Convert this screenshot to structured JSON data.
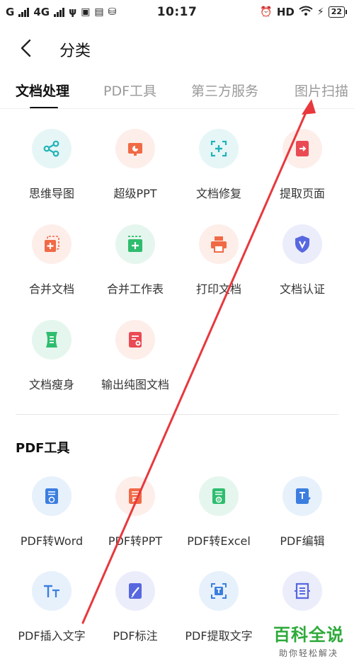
{
  "status_bar": {
    "carrier1": "G",
    "carrier2": "4G",
    "time": "10:17",
    "hd": "HD",
    "battery": "22"
  },
  "header": {
    "back_icon": "chevron-left-icon",
    "title": "分类"
  },
  "tabs": [
    {
      "label": "文档处理",
      "active": true
    },
    {
      "label": "PDF工具",
      "active": false
    },
    {
      "label": "第三方服务",
      "active": false
    },
    {
      "label": "图片扫描",
      "active": false
    }
  ],
  "doc_tools": [
    {
      "label": "思维导图",
      "icon": "mindmap-icon",
      "bg": "#e6f6f7",
      "color": "#21b3b8"
    },
    {
      "label": "超级PPT",
      "icon": "ppt-icon",
      "bg": "#fdeeea",
      "color": "#f06a45"
    },
    {
      "label": "文档修复",
      "icon": "doc-repair-icon",
      "bg": "#e6f6f7",
      "color": "#21b3b8"
    },
    {
      "label": "提取页面",
      "icon": "extract-page-icon",
      "bg": "#fdeeea",
      "color": "#ea4a53"
    },
    {
      "label": "合并文档",
      "icon": "merge-doc-icon",
      "bg": "#fdeeea",
      "color": "#f06a45"
    },
    {
      "label": "合并工作表",
      "icon": "merge-sheet-icon",
      "bg": "#e5f6ee",
      "color": "#2ebd6e"
    },
    {
      "label": "打印文档",
      "icon": "printer-icon",
      "bg": "#fdeeea",
      "color": "#f06a45"
    },
    {
      "label": "文档认证",
      "icon": "shield-icon",
      "bg": "#ebedfb",
      "color": "#5767e0"
    },
    {
      "label": "文档瘦身",
      "icon": "slim-doc-icon",
      "bg": "#e5f6ee",
      "color": "#2ebd6e"
    },
    {
      "label": "输出纯图文档",
      "icon": "image-doc-icon",
      "bg": "#fdeeea",
      "color": "#ea4a53"
    }
  ],
  "pdf_section": {
    "title": "PDF工具"
  },
  "pdf_tools": [
    {
      "label": "PDF转Word",
      "icon": "pdf-word-icon",
      "bg": "#e7f1fc",
      "color": "#3b7ee0"
    },
    {
      "label": "PDF转PPT",
      "icon": "pdf-ppt-icon",
      "bg": "#fdeeea",
      "color": "#f06a45"
    },
    {
      "label": "PDF转Excel",
      "icon": "pdf-excel-icon",
      "bg": "#e5f6ee",
      "color": "#2ebd6e"
    },
    {
      "label": "PDF编辑",
      "icon": "pdf-edit-icon",
      "bg": "#e7f1fc",
      "color": "#3b7ee0"
    },
    {
      "label": "PDF插入文字",
      "icon": "text-insert-icon",
      "bg": "#e7f1fc",
      "color": "#3b7ee0"
    },
    {
      "label": "PDF标注",
      "icon": "annotate-icon",
      "bg": "#ebedfb",
      "color": "#5767e0"
    },
    {
      "label": "PDF提取文字",
      "icon": "extract-text-icon",
      "bg": "#e7f1fc",
      "color": "#3b7ee0"
    },
    {
      "label": "",
      "icon": "document-list-icon",
      "bg": "#ebedfb",
      "color": "#5767e0"
    }
  ],
  "watermark": {
    "big": "百科全说",
    "small": "助你轻松解决"
  },
  "annotation_color": "#e8383d"
}
